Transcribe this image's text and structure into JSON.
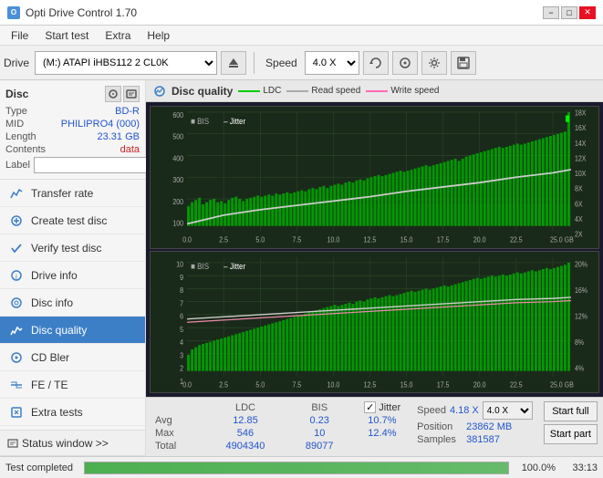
{
  "titlebar": {
    "title": "Opti Drive Control 1.70",
    "icon": "O",
    "minimize": "−",
    "maximize": "□",
    "close": "✕"
  },
  "menu": {
    "items": [
      "File",
      "Start test",
      "Extra",
      "Help"
    ]
  },
  "toolbar": {
    "drive_label": "Drive",
    "drive_value": "(M:)  ATAPI iHBS112  2 CL0K",
    "speed_label": "Speed",
    "speed_value": "4.0 X"
  },
  "disc": {
    "section_label": "Disc",
    "type_label": "Type",
    "type_value": "BD-R",
    "mid_label": "MID",
    "mid_value": "PHILIPRO4 (000)",
    "length_label": "Length",
    "length_value": "23.31 GB",
    "contents_label": "Contents",
    "contents_value": "data",
    "label_label": "Label",
    "label_placeholder": ""
  },
  "sidebar": {
    "nav_items": [
      {
        "label": "Transfer rate",
        "icon": "chart"
      },
      {
        "label": "Create test disc",
        "icon": "disc"
      },
      {
        "label": "Verify test disc",
        "icon": "check"
      },
      {
        "label": "Drive info",
        "icon": "info"
      },
      {
        "label": "Disc info",
        "icon": "disc2"
      },
      {
        "label": "Disc quality",
        "icon": "quality",
        "active": true
      },
      {
        "label": "CD Bler",
        "icon": "cd"
      },
      {
        "label": "FE / TE",
        "icon": "fe"
      },
      {
        "label": "Extra tests",
        "icon": "extra"
      }
    ],
    "status_window_label": "Status window >>"
  },
  "panel": {
    "title": "Disc quality",
    "legend": {
      "ldc_label": "LDC",
      "read_label": "Read speed",
      "write_label": "Write speed",
      "bis_label": "BIS",
      "jitter_label": "Jitter"
    },
    "chart1": {
      "y_max": 600,
      "y_ticks": [
        600,
        500,
        400,
        300,
        200,
        100
      ],
      "y_right": [
        "18X",
        "16X",
        "14X",
        "12X",
        "10X",
        "8X",
        "6X",
        "4X",
        "2X"
      ],
      "x_ticks": [
        "0.0",
        "2.5",
        "5.0",
        "7.5",
        "10.0",
        "12.5",
        "15.0",
        "17.5",
        "20.0",
        "22.5",
        "25.0 GB"
      ]
    },
    "chart2": {
      "y_max": 10,
      "y_ticks": [
        10,
        9,
        8,
        7,
        6,
        5,
        4,
        3,
        2,
        1
      ],
      "y_right": [
        "20%",
        "16%",
        "12%",
        "8%",
        "4%"
      ],
      "x_ticks": [
        "0.0",
        "2.5",
        "5.0",
        "7.5",
        "10.0",
        "12.5",
        "15.0",
        "17.5",
        "20.0",
        "22.5",
        "25.0 GB"
      ]
    }
  },
  "stats": {
    "headers": [
      "LDC",
      "BIS"
    ],
    "avg_label": "Avg",
    "max_label": "Max",
    "total_label": "Total",
    "ldc_avg": "12.85",
    "ldc_max": "546",
    "ldc_total": "4904340",
    "bis_avg": "0.23",
    "bis_max": "10",
    "bis_total": "89077",
    "jitter_label": "Jitter",
    "jitter_checked": true,
    "jitter_avg": "10.7%",
    "jitter_max": "12.4%",
    "speed_label": "Speed",
    "speed_value": "4.18 X",
    "speed_select": "4.0 X",
    "position_label": "Position",
    "position_value": "23862 MB",
    "samples_label": "Samples",
    "samples_value": "381587",
    "start_full_label": "Start full",
    "start_part_label": "Start part"
  },
  "progress": {
    "status_label": "Test completed",
    "percentage": "100.0%",
    "time": "33:13",
    "bar_value": 100
  },
  "colors": {
    "ldc_color": "#00ff00",
    "read_color": "#ffffff",
    "write_color": "#ff69b4",
    "bis_color": "#00cc00",
    "jitter_color": "#ffffff",
    "green_bar": "#4caf50",
    "blue_accent": "#3d7fc7"
  }
}
